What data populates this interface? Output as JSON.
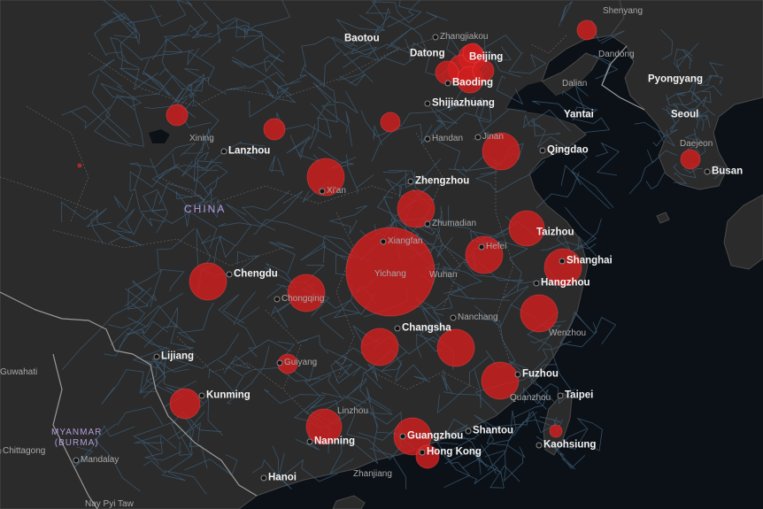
{
  "map": {
    "region": "East Asia",
    "colors": {
      "land": "#2b2b2b",
      "water": "#0c1117",
      "roads": "#3d5f7a",
      "borders": "#7c7c7c",
      "marker": "#d21e1e"
    },
    "country_labels": [
      {
        "name": "china",
        "text": "CHINA"
      },
      {
        "name": "myanmar",
        "text": "MYANMAR\n(BURMA)"
      }
    ],
    "city_labels": [
      {
        "name": "shenyang",
        "text": "Shenyang",
        "tier": "minor"
      },
      {
        "name": "zhangjiakou",
        "text": "Zhangjiakou",
        "tier": "minor"
      },
      {
        "name": "baotou",
        "text": "Baotou",
        "tier": "major"
      },
      {
        "name": "datong",
        "text": "Datong",
        "tier": "major"
      },
      {
        "name": "beijing",
        "text": "Beijing",
        "tier": "major"
      },
      {
        "name": "baoding",
        "text": "Baoding",
        "tier": "major"
      },
      {
        "name": "dandong",
        "text": "Dandong",
        "tier": "minor"
      },
      {
        "name": "dalian",
        "text": "Dalian",
        "tier": "minor"
      },
      {
        "name": "pyongyang",
        "text": "Pyongyang",
        "tier": "major"
      },
      {
        "name": "shijiazhuang",
        "text": "Shijiazhuang",
        "tier": "major"
      },
      {
        "name": "yantai",
        "text": "Yantai",
        "tier": "major"
      },
      {
        "name": "seoul",
        "text": "Seoul",
        "tier": "major"
      },
      {
        "name": "xining",
        "text": "Xining",
        "tier": "minor"
      },
      {
        "name": "handan",
        "text": "Handan",
        "tier": "minor"
      },
      {
        "name": "jinan",
        "text": "Jinan",
        "tier": "minor"
      },
      {
        "name": "daejeon",
        "text": "Daejeon",
        "tier": "minor"
      },
      {
        "name": "lanzhou",
        "text": "Lanzhou",
        "tier": "major"
      },
      {
        "name": "qingdao",
        "text": "Qingdao",
        "tier": "major"
      },
      {
        "name": "busan",
        "text": "Busan",
        "tier": "major"
      },
      {
        "name": "xian",
        "text": "Xi'an",
        "tier": "minor"
      },
      {
        "name": "zhengzhou",
        "text": "Zhengzhou",
        "tier": "major"
      },
      {
        "name": "zhumadian",
        "text": "Zhumadian",
        "tier": "minor"
      },
      {
        "name": "taizhou",
        "text": "Taizhou",
        "tier": "major"
      },
      {
        "name": "xiangfan",
        "text": "Xiangfan",
        "tier": "minor"
      },
      {
        "name": "hefei",
        "text": "Hefei",
        "tier": "minor"
      },
      {
        "name": "shanghai",
        "text": "Shanghai",
        "tier": "major"
      },
      {
        "name": "chengdu",
        "text": "Chengdu",
        "tier": "major"
      },
      {
        "name": "yichang",
        "text": "Yichang",
        "tier": "minor"
      },
      {
        "name": "wuhan",
        "text": "Wuhan",
        "tier": "minor"
      },
      {
        "name": "hangzhou",
        "text": "Hangzhou",
        "tier": "major"
      },
      {
        "name": "chongqing",
        "text": "Chongqing",
        "tier": "minor"
      },
      {
        "name": "nanchang",
        "text": "Nanchang",
        "tier": "minor"
      },
      {
        "name": "changsha",
        "text": "Changsha",
        "tier": "major"
      },
      {
        "name": "wenzhou",
        "text": "Wenzhou",
        "tier": "minor"
      },
      {
        "name": "lijiang",
        "text": "Lijiang",
        "tier": "major"
      },
      {
        "name": "guwahati",
        "text": "Guwahati",
        "tier": "minor"
      },
      {
        "name": "guiyang",
        "text": "Guiyang",
        "tier": "minor"
      },
      {
        "name": "fuzhou",
        "text": "Fuzhou",
        "tier": "major"
      },
      {
        "name": "kunming",
        "text": "Kunming",
        "tier": "major"
      },
      {
        "name": "taipei",
        "text": "Taipei",
        "tier": "major"
      },
      {
        "name": "quanzhou",
        "text": "Quanzhou",
        "tier": "minor"
      },
      {
        "name": "linzhou",
        "text": "Linzhou",
        "tier": "minor"
      },
      {
        "name": "shantou",
        "text": "Shantou",
        "tier": "major"
      },
      {
        "name": "nanning",
        "text": "Nanning",
        "tier": "major"
      },
      {
        "name": "guangzhou",
        "text": "Guangzhou",
        "tier": "major"
      },
      {
        "name": "chittagong",
        "text": "Chittagong",
        "tier": "minor"
      },
      {
        "name": "kaohsiung",
        "text": "Kaohsiung",
        "tier": "major"
      },
      {
        "name": "hong-kong",
        "text": "Hong Kong",
        "tier": "major"
      },
      {
        "name": "mandalay",
        "text": "Mandalay",
        "tier": "minor"
      },
      {
        "name": "hanoi",
        "text": "Hanoi",
        "tier": "major"
      },
      {
        "name": "zhanjiang",
        "text": "Zhanjiang",
        "tier": "minor"
      },
      {
        "name": "nay-pyi-taw",
        "text": "Nay Pyi Taw",
        "tier": "minor"
      }
    ],
    "marker_count": 31
  }
}
